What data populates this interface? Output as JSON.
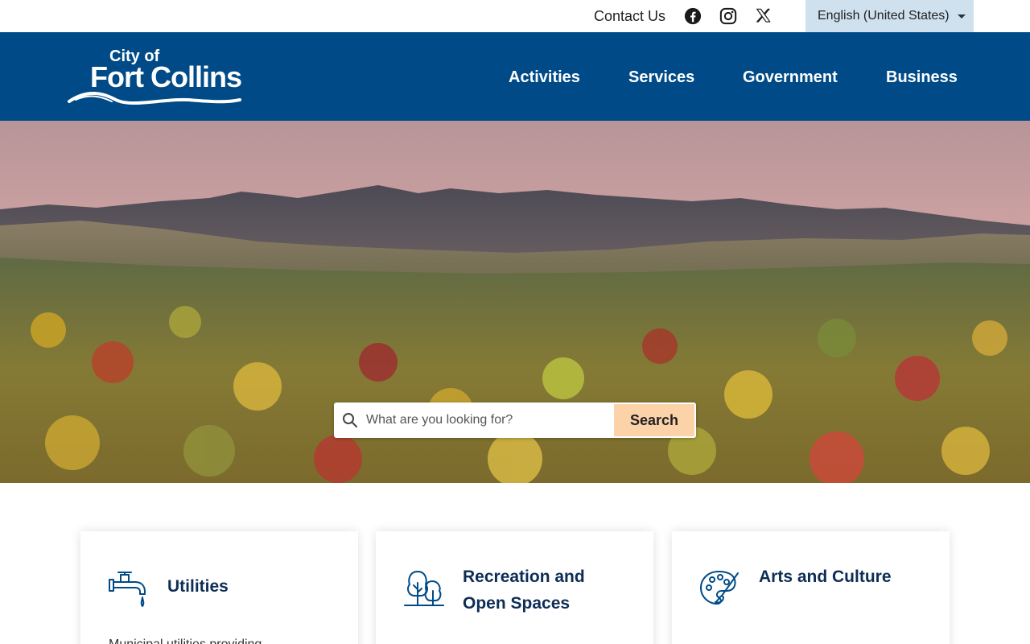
{
  "utility_bar": {
    "contact_label": "Contact Us",
    "social_icons": [
      "facebook-icon",
      "instagram-icon",
      "x-icon"
    ],
    "language_selected": "English (United States)"
  },
  "header": {
    "logo_text_top": "City of",
    "logo_text_main": "Fort Collins",
    "nav": [
      "Activities",
      "Services",
      "Government",
      "Business"
    ],
    "background_color": "#004b87"
  },
  "hero": {
    "search_placeholder": "What are you looking for?",
    "search_button_label": "Search",
    "search_button_color": "#fcd2a8"
  },
  "cards": [
    {
      "title": "Utilities",
      "icon": "faucet-icon",
      "desc": "Municipal utilities providing"
    },
    {
      "title": "Recreation and Open Spaces",
      "icon": "trees-icon",
      "desc": ""
    },
    {
      "title": "Arts and Culture",
      "icon": "palette-icon",
      "desc": ""
    }
  ]
}
